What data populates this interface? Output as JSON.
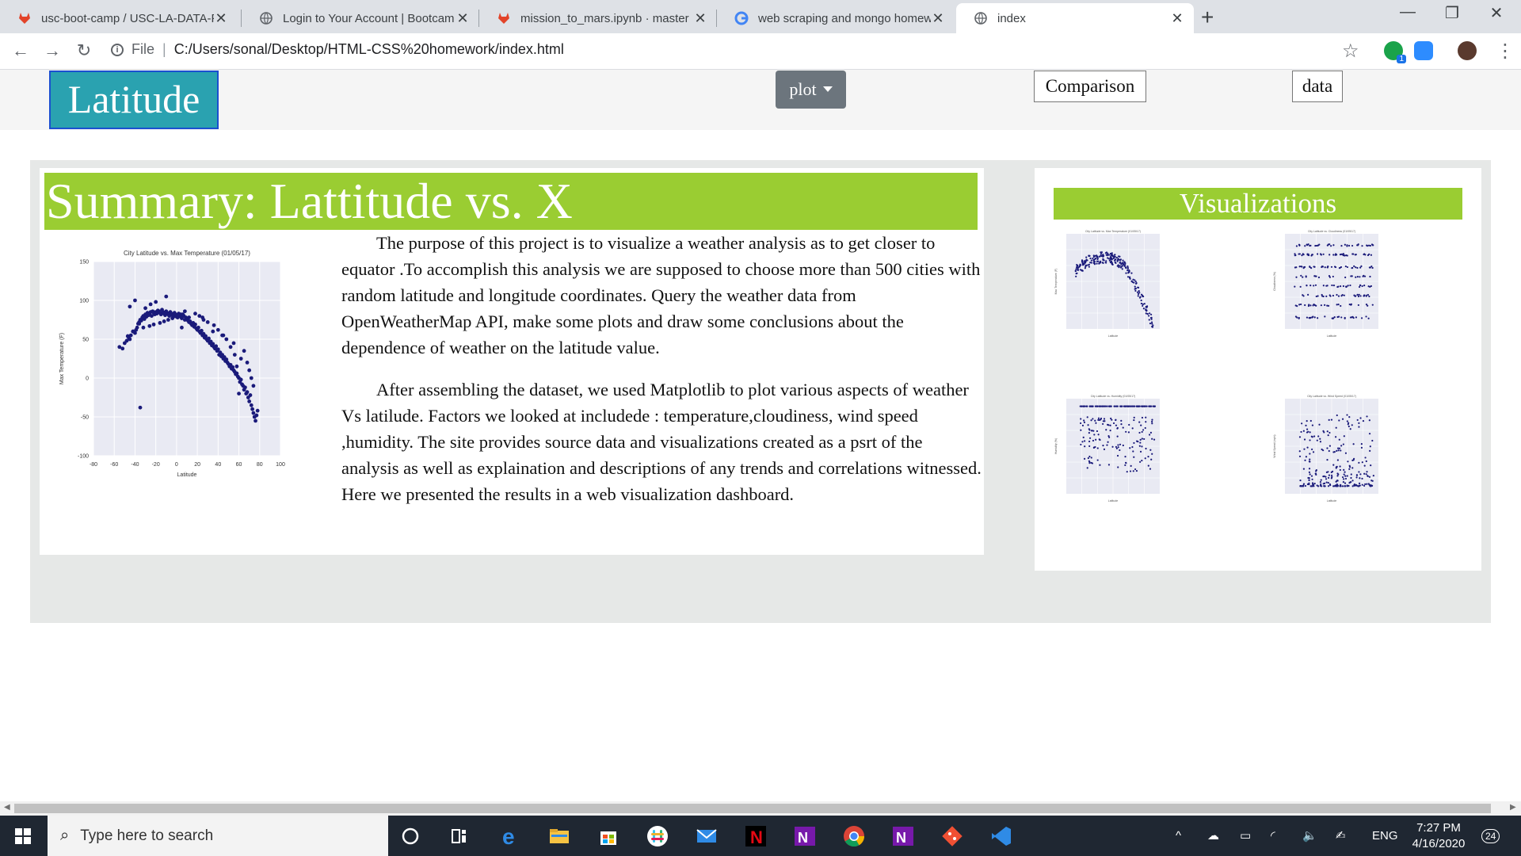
{
  "browser": {
    "tabs": [
      {
        "title": "usc-boot-camp / USC-LA-DATA-F",
        "icon": "gitlab-icon",
        "active": false
      },
      {
        "title": "Login to Your Account | Bootcam",
        "icon": "globe-icon",
        "active": false
      },
      {
        "title": "mission_to_mars.ipynb · master ·",
        "icon": "gitlab-icon",
        "active": false
      },
      {
        "title": "web scraping and mongo homew",
        "icon": "google-icon",
        "active": false
      },
      {
        "title": "index",
        "icon": "globe-icon",
        "active": true
      }
    ],
    "new_tab": "+",
    "address": {
      "scheme_label": "File",
      "url": "C:/Users/sonal/Desktop/HTML-CSS%20homework/index.html"
    },
    "extension_badge": "1"
  },
  "navbar": {
    "brand": "Latitude",
    "plot_dropdown": "plot",
    "comparison": "Comparison",
    "data": "data"
  },
  "summary": {
    "title": "Summary: Lattitude vs. X",
    "paragraphs": [
      "The purpose of this project is to visualize a weather analysis as to get closer to equator .To accomplish this analysis we are supposed to choose more than 500 cities with random latitude and longitude coordinates. Query the weather data from OpenWeatherMap API, make some plots and draw some conclusions about the dependence of weather on the latitude value.",
      "After assembling the dataset, we used Matplotlib to plot various aspects of weather Vs latilude. Factors we looked at includede : temperature,cloudiness, wind speed ,humidity. The site provides source data and visualizations created as a psrt of the analysis as well as explaination and descriptions of any trends and correlations witnessed. Here we presented the results in a web visualization dashboard."
    ]
  },
  "visualizations": {
    "title": "Visualizations"
  },
  "chart_data": [
    {
      "type": "scatter",
      "title": "City Latitude vs. Max Temperature (01/05/17)",
      "xlabel": "Latitude",
      "ylabel": "Max Temperature (F)",
      "xlim": [
        -80,
        100
      ],
      "ylim": [
        -100,
        150
      ],
      "xticks": [
        -80,
        -60,
        -40,
        -20,
        0,
        20,
        40,
        60,
        80,
        100
      ],
      "yticks": [
        150,
        100,
        50,
        0,
        -50,
        -100
      ],
      "grid": true,
      "color": "#1a1a7a",
      "x": [
        -55,
        -52,
        -50,
        -48,
        -46,
        -45,
        -44,
        -42,
        -40,
        -39,
        -38,
        -37,
        -36,
        -35,
        -34,
        -33,
        -32,
        -31,
        -30,
        -29,
        -28,
        -27,
        -26,
        -25,
        -24,
        -23,
        -22,
        -21,
        -20,
        -19,
        -18,
        -17,
        -16,
        -15,
        -14,
        -13,
        -12,
        -11,
        -10,
        -9,
        -8,
        -7,
        -6,
        -5,
        -4,
        -3,
        -2,
        -1,
        0,
        1,
        2,
        3,
        4,
        5,
        6,
        7,
        8,
        9,
        10,
        11,
        12,
        13,
        14,
        15,
        16,
        17,
        18,
        19,
        20,
        21,
        22,
        23,
        24,
        25,
        26,
        27,
        28,
        29,
        30,
        31,
        32,
        33,
        34,
        35,
        36,
        37,
        38,
        39,
        40,
        41,
        42,
        43,
        44,
        45,
        46,
        47,
        48,
        49,
        50,
        51,
        52,
        53,
        54,
        55,
        56,
        57,
        58,
        59,
        60,
        61,
        62,
        63,
        64,
        65,
        66,
        67,
        68,
        69,
        70,
        71,
        72,
        73,
        74,
        75,
        76,
        77,
        78,
        -35,
        -30,
        -25,
        -20,
        -45,
        -40,
        -10,
        5,
        15,
        25,
        35,
        45,
        55,
        62,
        65,
        68,
        70,
        72,
        74,
        60,
        58,
        56,
        52,
        48,
        44,
        40,
        36,
        30,
        26,
        22,
        18,
        12,
        8,
        4,
        0,
        -4,
        -8,
        -12,
        -16,
        -22,
        -26,
        -32,
        -36,
        -42,
        -47
      ],
      "y": [
        40,
        38,
        45,
        48,
        52,
        50,
        55,
        60,
        58,
        62,
        65,
        70,
        72,
        75,
        74,
        78,
        80,
        76,
        82,
        79,
        84,
        81,
        83,
        85,
        80,
        86,
        84,
        82,
        85,
        83,
        87,
        86,
        84,
        82,
        88,
        85,
        83,
        81,
        86,
        84,
        82,
        80,
        85,
        83,
        81,
        79,
        84,
        82,
        80,
        78,
        83,
        81,
        79,
        77,
        82,
        80,
        75,
        78,
        76,
        74,
        72,
        73,
        70,
        68,
        71,
        66,
        69,
        64,
        62,
        65,
        60,
        58,
        61,
        55,
        57,
        52,
        54,
        50,
        48,
        51,
        45,
        47,
        42,
        44,
        40,
        38,
        41,
        35,
        37,
        30,
        33,
        28,
        30,
        25,
        27,
        22,
        24,
        20,
        18,
        15,
        17,
        12,
        14,
        10,
        8,
        5,
        6,
        2,
        0,
        -5,
        -2,
        -8,
        -10,
        -15,
        -12,
        -20,
        -18,
        -25,
        -30,
        -22,
        -35,
        -40,
        -45,
        -50,
        -55,
        -48,
        -42,
        -38,
        90,
        95,
        98,
        92,
        100,
        105,
        65,
        70,
        78,
        60,
        55,
        45,
        25,
        35,
        20,
        10,
        0,
        -10,
        -20,
        15,
        30,
        40,
        50,
        55,
        62,
        68,
        72,
        75,
        80,
        83,
        78,
        86,
        82,
        79,
        77,
        75,
        73,
        71,
        69,
        67,
        65,
        70,
        60,
        54,
        50
      ]
    },
    {
      "type": "scatter",
      "title": "City Latitude vs. Max Temperature (01/05/17)",
      "xlabel": "Latitude",
      "ylabel": "Max Temperature (F)",
      "shape": "arch"
    },
    {
      "type": "scatter",
      "title": "City Latitude vs. Cloudiness (01/05/17)",
      "xlabel": "Latitude",
      "ylabel": "Cloudiness (%)",
      "shape": "bands"
    },
    {
      "type": "scatter",
      "title": "City Latitude vs. Humidity (01/05/17)",
      "xlabel": "Latitude",
      "ylabel": "Humidity (%)",
      "shape": "ceiling"
    },
    {
      "type": "scatter",
      "title": "City Latitude vs. Wind Speed (01/05/17)",
      "xlabel": "Latitude",
      "ylabel": "Wind Speed (mph)",
      "shape": "floor"
    }
  ],
  "taskbar": {
    "search_placeholder": "Type here to search",
    "language": "ENG",
    "time": "7:27 PM",
    "date": "4/16/2020",
    "notifications": "24",
    "apps": [
      "cortana-icon",
      "task-view-icon",
      "edge-icon",
      "file-explorer-icon",
      "store-icon",
      "slack-icon",
      "mail-icon",
      "netflix-icon",
      "onenote-icon",
      "chrome-icon",
      "onenote-icon",
      "git-icon",
      "vscode-icon"
    ]
  },
  "colors": {
    "brand_bg": "#2aa2b0",
    "accent_green": "#9acd32",
    "container_bg": "#e6e8e7",
    "plot_button": "#6c757d",
    "point_color": "#1a1a7a"
  }
}
